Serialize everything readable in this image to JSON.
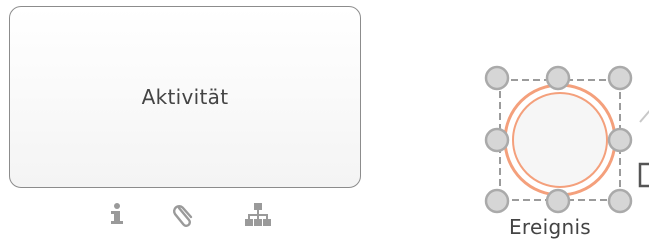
{
  "canvas": {
    "task": {
      "label": "Aktivität",
      "icons": [
        "info-icon",
        "attachment-icon",
        "hierarchy-icon"
      ]
    },
    "event": {
      "label": "Ereignis",
      "selected": true,
      "ring_color": "#f4a07c"
    }
  },
  "colors": {
    "task_border": "#8c8c8c",
    "text": "#444444",
    "icon": "#9a9a9a",
    "handle": "#bdbdbd"
  }
}
